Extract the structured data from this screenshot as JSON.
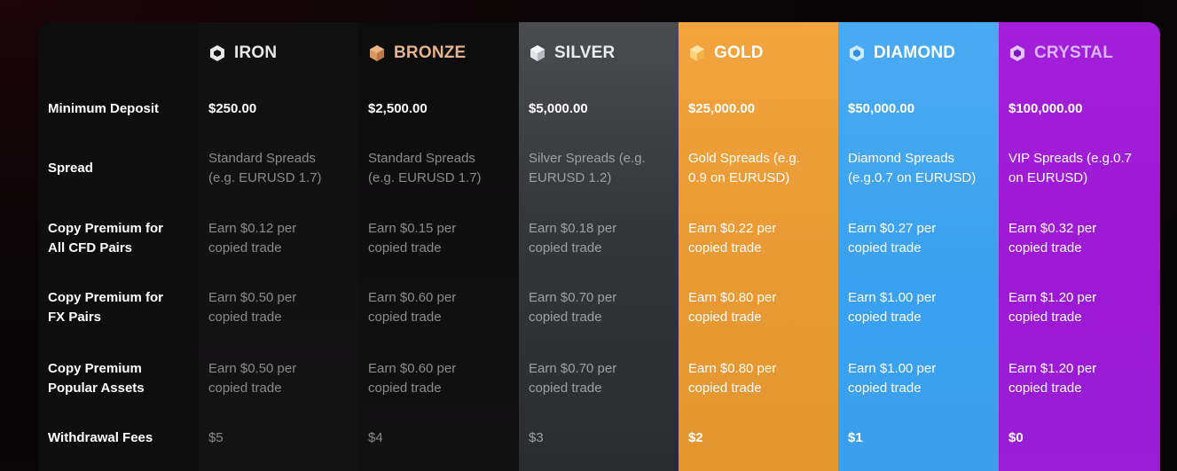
{
  "labels": {
    "min_deposit": "Minimum Deposit",
    "spread": "Spread",
    "copy_cfd": [
      "Copy Premium for",
      "All CFD Pairs"
    ],
    "copy_fx": [
      "Copy Premium for",
      "FX Pairs"
    ],
    "copy_popular": [
      "Copy Premium",
      "Popular Assets"
    ],
    "withdrawal": "Withdrawal Fees"
  },
  "tiers": [
    {
      "key": "iron",
      "name": "IRON",
      "icon": "iron-shield-icon",
      "icon_color": "#e8e8e8",
      "min_deposit": "$250.00",
      "spread": [
        "Standard Spreads",
        "(e.g. EURUSD 1.7)"
      ],
      "copy_cfd": [
        "Earn $0.12 per",
        "copied trade"
      ],
      "copy_fx": [
        "Earn $0.50 per",
        "copied trade"
      ],
      "copy_popular": [
        "Earn $0.50 per",
        "copied trade"
      ],
      "withdrawal": "$5"
    },
    {
      "key": "bronze",
      "name": "BRONZE",
      "icon": "bronze-shield-icon",
      "icon_color": "#d99a62",
      "min_deposit": "$2,500.00",
      "spread": [
        "Standard Spreads",
        "(e.g. EURUSD 1.7)"
      ],
      "copy_cfd": [
        "Earn $0.15 per",
        "copied trade"
      ],
      "copy_fx": [
        "Earn $0.60 per",
        "copied trade"
      ],
      "copy_popular": [
        "Earn $0.60 per",
        "copied trade"
      ],
      "withdrawal": "$4"
    },
    {
      "key": "silver",
      "name": "SILVER",
      "icon": "silver-shield-icon",
      "icon_color": "#dfe2e6",
      "min_deposit": "$5,000.00",
      "spread": [
        "Silver Spreads (e.g.",
        "EURUSD 1.2)"
      ],
      "copy_cfd": [
        "Earn $0.18 per",
        "copied trade"
      ],
      "copy_fx": [
        "Earn $0.70 per",
        "copied trade"
      ],
      "copy_popular": [
        "Earn $0.70 per",
        "copied trade"
      ],
      "withdrawal": "$3"
    },
    {
      "key": "gold",
      "name": "GOLD",
      "icon": "gold-shield-icon",
      "icon_color": "#ffd27a",
      "min_deposit": "$25,000.00",
      "spread": [
        "Gold Spreads (e.g.",
        "0.9 on EURUSD)"
      ],
      "copy_cfd": [
        "Earn $0.22 per",
        "copied trade"
      ],
      "copy_fx": [
        "Earn $0.80 per",
        "copied trade"
      ],
      "copy_popular": [
        "Earn $0.80 per",
        "copied trade"
      ],
      "withdrawal": "$2"
    },
    {
      "key": "diamond",
      "name": "DIAMOND",
      "icon": "diamond-shield-icon",
      "icon_color": "#c9ecff",
      "min_deposit": "$50,000.00",
      "spread": [
        "Diamond Spreads",
        "(e.g.0.7 on EURUSD)"
      ],
      "copy_cfd": [
        "Earn $0.27 per",
        "copied trade"
      ],
      "copy_fx": [
        "Earn $1.00 per",
        "copied trade"
      ],
      "copy_popular": [
        "Earn $1.00 per",
        "copied trade"
      ],
      "withdrawal": "$1"
    },
    {
      "key": "crystal",
      "name": "CRYSTAL",
      "icon": "crystal-shield-icon",
      "icon_color": "#e2c7ff",
      "min_deposit": "$100,000.00",
      "spread": [
        "VIP Spreads (e.g.0.7",
        "on EURUSD)"
      ],
      "copy_cfd": [
        "Earn $0.32 per",
        "copied trade"
      ],
      "copy_fx": [
        "Earn $1.20 per",
        "copied trade"
      ],
      "copy_popular": [
        "Earn $1.20 per",
        "copied trade"
      ],
      "withdrawal": "$0"
    }
  ]
}
